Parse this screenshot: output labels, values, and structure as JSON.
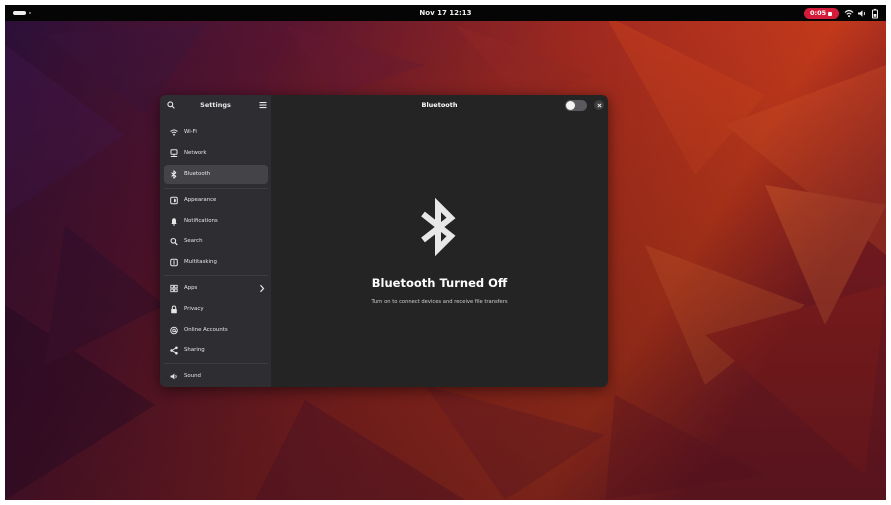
{
  "topbar": {
    "clock": "Nov 17  12:13",
    "recording_time": "0:05",
    "tray_icons": [
      "wifi-icon",
      "volume-icon",
      "battery-icon"
    ]
  },
  "settings": {
    "sidebar": {
      "title": "Settings",
      "items": [
        {
          "label": "Wi-Fi",
          "icon": "wifi-icon"
        },
        {
          "label": "Network",
          "icon": "network-icon"
        },
        {
          "label": "Bluetooth",
          "icon": "bluetooth-icon",
          "selected": true
        },
        {
          "label": "Appearance",
          "icon": "appearance-icon"
        },
        {
          "label": "Notifications",
          "icon": "bell-icon"
        },
        {
          "label": "Search",
          "icon": "search-icon"
        },
        {
          "label": "Multitasking",
          "icon": "multitasking-icon"
        },
        {
          "label": "Apps",
          "icon": "apps-icon"
        },
        {
          "label": "Privacy",
          "icon": "privacy-icon"
        },
        {
          "label": "Online Accounts",
          "icon": "online-accounts-icon"
        },
        {
          "label": "Sharing",
          "icon": "share-icon"
        },
        {
          "label": "Sound",
          "icon": "sound-icon"
        }
      ]
    },
    "content": {
      "title": "Bluetooth",
      "toggle_on": false,
      "empty_title": "Bluetooth Turned Off",
      "empty_description": "Turn on to connect devices and receive file transfers"
    }
  },
  "colors": {
    "recording": "#d51b3a",
    "sidebar_bg": "#2e2e32",
    "content_bg": "#242424",
    "selected_item": "#444448"
  }
}
